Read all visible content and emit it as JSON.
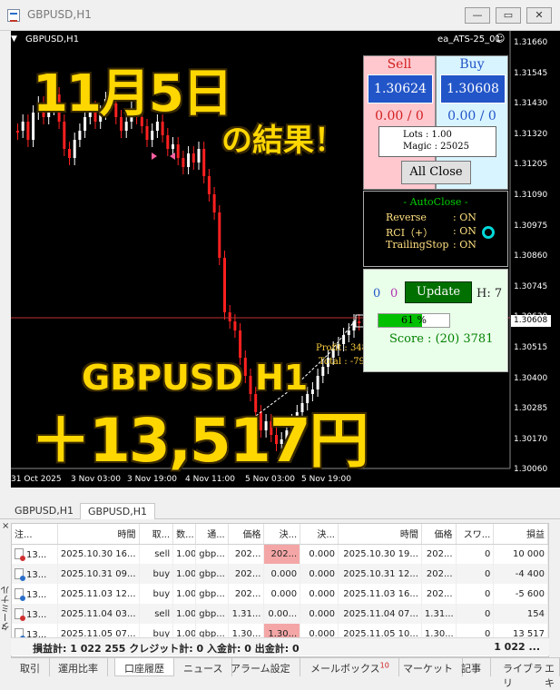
{
  "window": {
    "title": "GBPUSD,H1"
  },
  "chart": {
    "symbol": "GBPUSD,H1",
    "ea_name": "ea_ATS-25_01",
    "overlay": {
      "line1": "11月5日",
      "line2": "の結果！",
      "line3": "GBPUSD H1",
      "line4": "＋13,517円"
    },
    "price_ticks": [
      "1.31660",
      "1.31545",
      "1.31430",
      "1.31320",
      "1.31205",
      "1.31090",
      "1.30975",
      "1.30860",
      "1.30745",
      "1.30630",
      "1.30515",
      "1.30400",
      "1.30285",
      "1.30170",
      "1.30060"
    ],
    "current_price": "1.30608",
    "time_ticks": [
      "31 Oct 2025",
      "3 Nov 03:00",
      "3 Nov 19:00",
      "4 Nov 11:00",
      "5 Nov 03:00",
      "5 Nov 19:00"
    ],
    "profit_label": "Profit : 348 p",
    "total_label": "Total : -79 p",
    "box_label": "614"
  },
  "ea_panel": {
    "sell_label": "Sell",
    "buy_label": "Buy",
    "sell_price": "1.30624",
    "buy_price": "1.30608",
    "sell_pl": "0.00 / 0",
    "buy_pl": "0.00 / 0",
    "lots": "Lots   : 1.00",
    "magic": "Magic : 25025",
    "all_close": "All Close",
    "autoclose_title": "- AutoClose -",
    "reverse_label": "Reverse",
    "reverse_value": ": ON",
    "rci_label": "RCI（+）",
    "rci_value": ": ON",
    "trailing_label": "TrailingStop",
    "trailing_value": ": ON",
    "counter_a": "0",
    "counter_b": "0",
    "update_label": "Update",
    "h_label": "H: 7",
    "progress_text": "61 %",
    "progress_value": 61,
    "score": "Score : (20) 3781"
  },
  "terminal": {
    "chart_tabs": [
      "GBPUSD,H1",
      "GBPUSD,H1"
    ],
    "columns": [
      "注...",
      "時間",
      "取...",
      "数...",
      "通...",
      "価格",
      "決...",
      "決...",
      "時間",
      "価格",
      "スワ...",
      "損益"
    ],
    "rows": [
      {
        "type": "sell",
        "cells": [
          "13...",
          "2025.10.30 16...",
          "sell",
          "1.00",
          "gbp...",
          "202...",
          "202...",
          "0.000",
          "2025.10.30 19...",
          "202...",
          "0",
          "10 000"
        ],
        "hl": 6
      },
      {
        "type": "buy",
        "cells": [
          "13...",
          "2025.10.31 09...",
          "buy",
          "1.00",
          "gbp...",
          "202...",
          "0.000",
          "0.000",
          "2025.10.31 12...",
          "202...",
          "0",
          "-4 400"
        ],
        "hl": -1
      },
      {
        "type": "buy",
        "cells": [
          "13...",
          "2025.11.03 12...",
          "buy",
          "1.00",
          "gbp...",
          "202...",
          "0.000",
          "0.000",
          "2025.11.03 16...",
          "202...",
          "0",
          "-5 600"
        ],
        "hl": -1
      },
      {
        "type": "sell",
        "cells": [
          "13...",
          "2025.11.04 03...",
          "sell",
          "1.00",
          "gbp...",
          "1.31...",
          "0.00...",
          "0.000",
          "2025.11.04 07...",
          "1.31...",
          "0",
          "154"
        ],
        "hl": -1
      },
      {
        "type": "buy",
        "cells": [
          "13...",
          "2025.11.05 07...",
          "buy",
          "1.00",
          "gbp...",
          "1.30...",
          "1.30...",
          "0.000",
          "2025.11.05 10...",
          "1.30...",
          "0",
          "13 517"
        ],
        "hl": 6
      }
    ],
    "summary": "損益計: 1 022 255  クレジット計: 0  入金計: 0  出金計: 0",
    "summary_total": "1 022 ...",
    "bottom_tabs": [
      "取引",
      "運用比率",
      "口座履歴",
      "ニュース",
      "アラーム設定",
      "メールボックス",
      "マーケット",
      "記事",
      "ライブラリ",
      "エキ"
    ],
    "mailbox_badge": "10",
    "side_label": "ターミナル",
    "close_icon": "×"
  },
  "colors": {
    "bull": "#ffffff",
    "bear": "#ff2020",
    "accent": "#2255c8"
  }
}
